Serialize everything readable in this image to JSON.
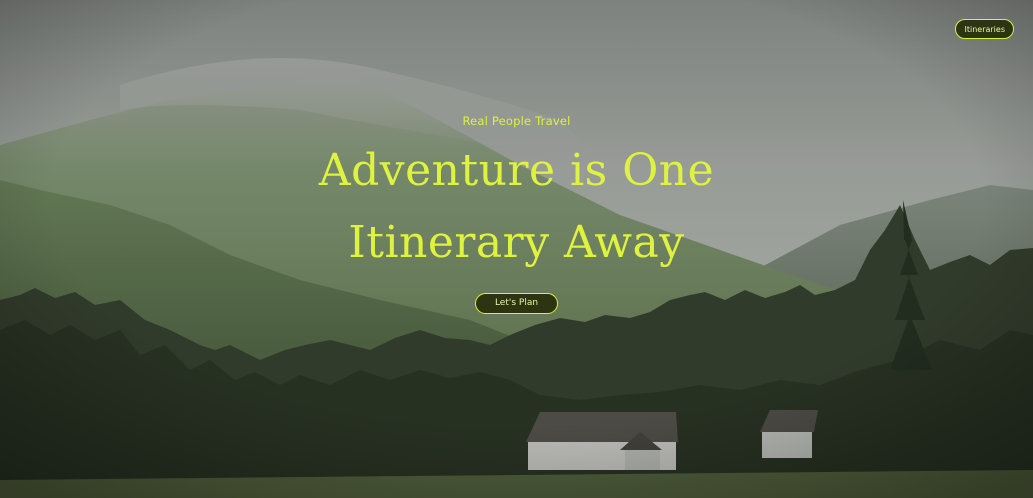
{
  "nav": {
    "itineraries_label": "Itineraries"
  },
  "hero": {
    "kicker": "Real People Travel",
    "headline_line1": "Adventure is One",
    "headline_line2": "Itinerary Away",
    "cta_label": "Let's Plan"
  },
  "colors": {
    "accent": "#dff23f",
    "button_bg": "#2c3412",
    "sky": "#8f948f",
    "forest": "#25301f"
  }
}
